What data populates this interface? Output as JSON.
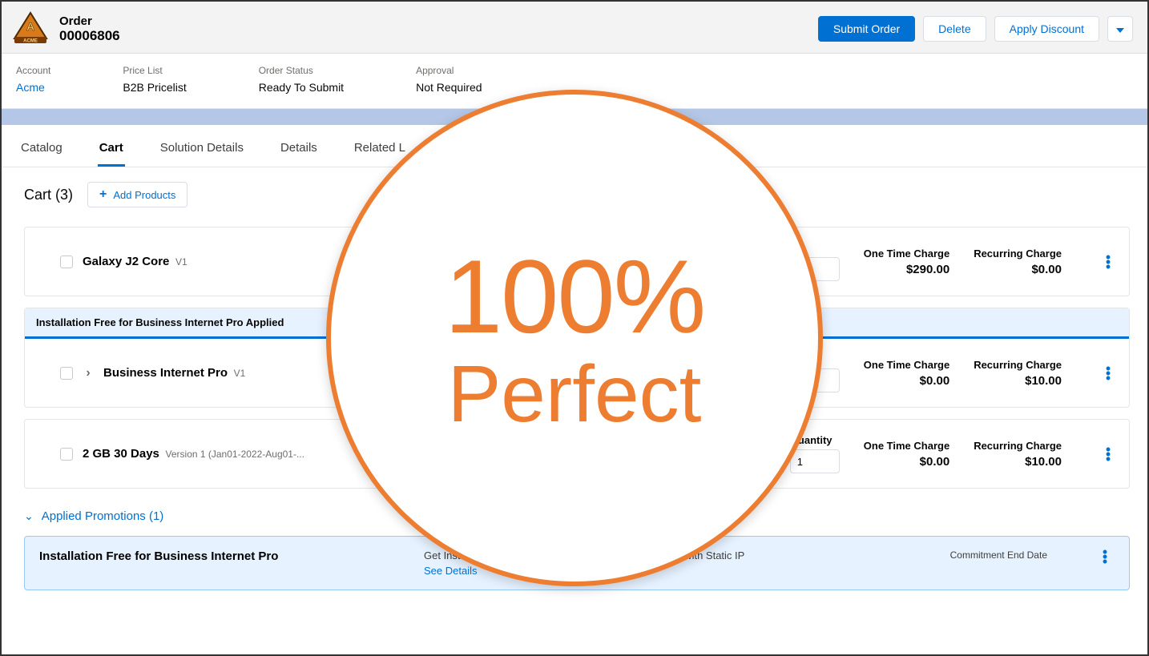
{
  "header": {
    "object_label": "Order",
    "order_number": "00006806",
    "submit": "Submit Order",
    "delete": "Delete",
    "apply_discount": "Apply Discount"
  },
  "info": {
    "account_lbl": "Account",
    "account_val": "Acme",
    "pricelist_lbl": "Price List",
    "pricelist_val": "B2B Pricelist",
    "status_lbl": "Order Status",
    "status_val": "Ready To Submit",
    "approval_lbl": "Approval",
    "approval_val": "Not Required"
  },
  "tabs": {
    "catalog": "Catalog",
    "cart": "Cart",
    "solution": "Solution Details",
    "details": "Details",
    "related": "Related L"
  },
  "cart": {
    "title": "Cart (3)",
    "add": "Add Products",
    "promo_applied_banner": "Installation Free for Business Internet Pro Applied",
    "cols": {
      "qty": "Quantity",
      "otc": "One Time Charge",
      "rc": "Recurring Charge"
    },
    "items": [
      {
        "name": "Galaxy J2 Core",
        "ver": "V1",
        "qty": "",
        "otc": "$290.00",
        "rc": "$0.00",
        "expandable": false
      },
      {
        "name": "Business Internet Pro",
        "ver": "V1",
        "qty": "",
        "otc": "$0.00",
        "rc": "$10.00",
        "expandable": true
      },
      {
        "name": "2 GB 30 Days",
        "ver": "Version 1 (Jan01-2022-Aug01-...",
        "qty": "1",
        "otc": "$0.00",
        "rc": "$10.00",
        "expandable": false
      }
    ]
  },
  "promos": {
    "toggle": "Applied Promotions (1)",
    "item": {
      "name": "Installation Free for Business Internet Pro",
      "desc": "Get Installation Free when buying Business Internet Pro with Static IP",
      "see": "See Details",
      "date_lbl": "Commitment End Date"
    }
  },
  "overlay": {
    "l1": "100%",
    "l2": "Perfect"
  }
}
